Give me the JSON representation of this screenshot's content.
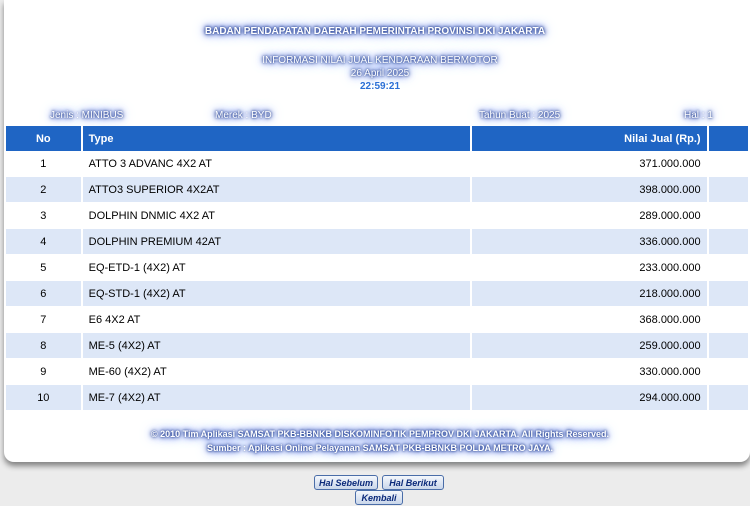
{
  "header": {
    "agency": "BADAN PENDAPATAN DAERAH PEMERINTAH PROVINSI DKI JAKARTA",
    "subtitle": "INFORMASI NILAI JUAL KENDARAAN BERMOTOR",
    "date": "26 April 2025",
    "time": "22:59:21"
  },
  "info": {
    "jenis": "Jenis : MINIBUS",
    "merek": "Merek : BYD",
    "tahun": "Tahun Buat : 2025",
    "hal": "Hal : 1"
  },
  "table": {
    "headers": [
      "No",
      "Type",
      "Nilai Jual (Rp.)"
    ],
    "rows": [
      {
        "no": "1",
        "type": "ATTO 3 ADVANC 4X2 AT",
        "value": "371.000.000"
      },
      {
        "no": "2",
        "type": "ATTO3 SUPERIOR 4X2AT",
        "value": "398.000.000"
      },
      {
        "no": "3",
        "type": "DOLPHIN DNMIC 4X2 AT",
        "value": "289.000.000"
      },
      {
        "no": "4",
        "type": "DOLPHIN PREMIUM 42AT",
        "value": "336.000.000"
      },
      {
        "no": "5",
        "type": "EQ-ETD-1 (4X2) AT",
        "value": "233.000.000"
      },
      {
        "no": "6",
        "type": "EQ-STD-1 (4X2) AT",
        "value": "218.000.000"
      },
      {
        "no": "7",
        "type": "E6 4X2 AT",
        "value": "368.000.000"
      },
      {
        "no": "8",
        "type": "ME-5 (4X2) AT",
        "value": "259.000.000"
      },
      {
        "no": "9",
        "type": "ME-60 (4X2) AT",
        "value": "330.000.000"
      },
      {
        "no": "10",
        "type": "ME-7 (4X2) AT",
        "value": "294.000.000"
      }
    ]
  },
  "footer": {
    "copyright": "© 2010 Tim Aplikasi SAMSAT PKB-BBNKB DISKOMINFOTIK PEMPROV DKI JAKARTA. All Rights Reserved.",
    "source": "Sumber : Aplikasi Online Pelayanan SAMSAT PKB-BBNKB POLDA METRO JAYA."
  },
  "buttons": {
    "prev": "Hal Sebelum",
    "next": "Hal Berikut",
    "back": "Kembali"
  }
}
